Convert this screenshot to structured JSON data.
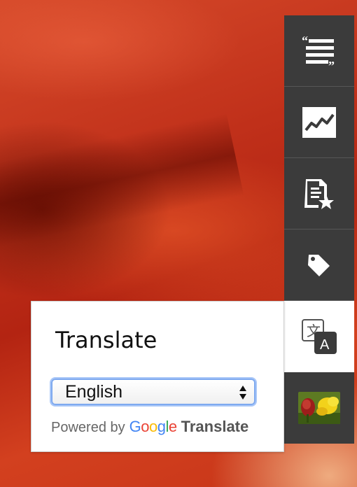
{
  "toolbar": {
    "items": [
      {
        "icon": "quote-text-icon"
      },
      {
        "icon": "trend-chart-icon"
      },
      {
        "icon": "document-star-icon"
      },
      {
        "icon": "tag-icon"
      },
      {
        "icon": "translate-icon"
      },
      {
        "icon": "flower-thumbnail"
      }
    ]
  },
  "translate_panel": {
    "title": "Translate",
    "selected_language": "English",
    "powered_by": "Powered by",
    "google_letters": [
      "G",
      "o",
      "o",
      "g",
      "l",
      "e"
    ],
    "translate_label": "Translate"
  },
  "colors": {
    "toolbar_bg": "#3b3b3b",
    "active_tool_bg": "#ffffff",
    "select_focus": "#7ea9ef"
  }
}
